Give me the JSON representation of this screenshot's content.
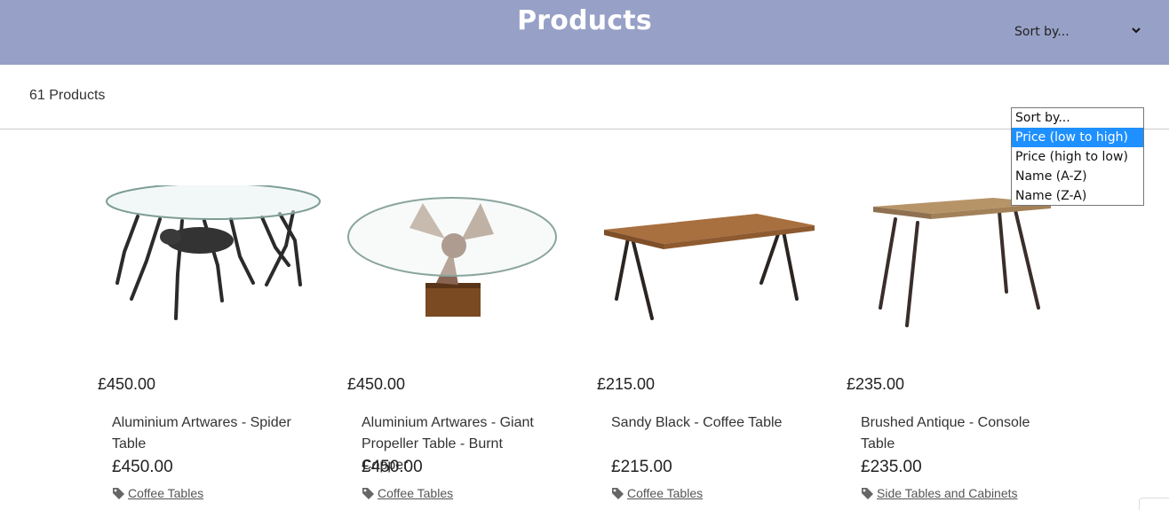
{
  "header": {
    "title": "Products"
  },
  "toolbar": {
    "count_label": "61 Products",
    "sort": {
      "value": "Sort by...",
      "options": [
        "Sort by...",
        "Price (low to high)",
        "Price (high to low)",
        "Name (A-Z)",
        "Name (Z-A)"
      ],
      "highlighted_index": 1
    }
  },
  "products": [
    {
      "price": "£450.00",
      "name": "Aluminium Artwares - Spider Table",
      "price2": "£450.00",
      "category": "Coffee Tables",
      "image": "spider-table"
    },
    {
      "price": "£450.00",
      "name": "Aluminium Artwares - Giant Propeller Table - Burnt Copper",
      "price2": "£450.00",
      "category": "Coffee Tables",
      "image": "propeller-table"
    },
    {
      "price": "£215.00",
      "name": "Sandy Black - Coffee Table",
      "price2": "£215.00",
      "category": "Coffee Tables",
      "image": "wood-coffee-table"
    },
    {
      "price": "£235.00",
      "name": "Brushed Antique - Console Table",
      "price2": "£235.00",
      "category": "Side Tables and Cabinets",
      "image": "console-table"
    }
  ],
  "colors": {
    "header_bg": "#97a0c6",
    "highlight": "#1e90ff"
  }
}
